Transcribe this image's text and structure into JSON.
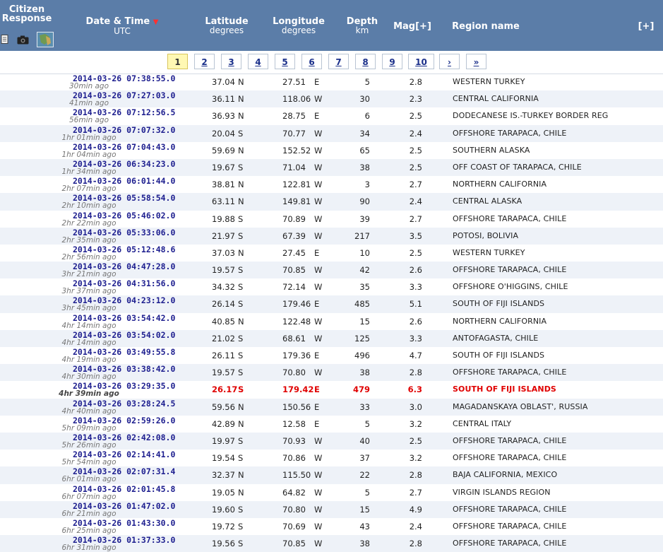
{
  "header": {
    "citizen": "Citizen",
    "response": "Response",
    "datetime": "Date & Time",
    "sort_arrow": "▼",
    "utc": "UTC",
    "latitude": "Latitude",
    "lat_unit": "degrees",
    "longitude": "Longitude",
    "lon_unit": "degrees",
    "depth": "Depth",
    "depth_unit": "km",
    "mag": "Mag[+]",
    "region": "Region name",
    "expand": "[+]"
  },
  "pager": [
    "1",
    "2",
    "3",
    "4",
    "5",
    "6",
    "7",
    "8",
    "9",
    "10",
    "›",
    "»"
  ],
  "rows": [
    {
      "datetime": "2014-03-26  07:38:55.0",
      "ago": "30min ago",
      "lat": "37.04",
      "ns": "N",
      "lon": "27.51",
      "ew": "E",
      "depth": "5",
      "mag": "2.8",
      "region": "WESTERN TURKEY"
    },
    {
      "datetime": "2014-03-26  07:27:03.0",
      "ago": "41min ago",
      "lat": "36.11",
      "ns": "N",
      "lon": "118.06",
      "ew": "W",
      "depth": "30",
      "mag": "2.3",
      "region": "CENTRAL CALIFORNIA"
    },
    {
      "datetime": "2014-03-26  07:12:56.5",
      "ago": "56min ago",
      "lat": "36.93",
      "ns": "N",
      "lon": "28.75",
      "ew": "E",
      "depth": "6",
      "mag": "2.5",
      "region": "DODECANESE IS.-TURKEY BORDER REG"
    },
    {
      "datetime": "2014-03-26  07:07:32.0",
      "ago": "1hr 01min ago",
      "lat": "20.04",
      "ns": "S",
      "lon": "70.77",
      "ew": "W",
      "depth": "34",
      "mag": "2.4",
      "region": "OFFSHORE TARAPACA, CHILE"
    },
    {
      "datetime": "2014-03-26  07:04:43.0",
      "ago": "1hr 04min ago",
      "lat": "59.69",
      "ns": "N",
      "lon": "152.52",
      "ew": "W",
      "depth": "65",
      "mag": "2.5",
      "region": "SOUTHERN ALASKA"
    },
    {
      "datetime": "2014-03-26  06:34:23.0",
      "ago": "1hr 34min ago",
      "lat": "19.67",
      "ns": "S",
      "lon": "71.04",
      "ew": "W",
      "depth": "38",
      "mag": "2.5",
      "region": "OFF COAST OF TARAPACA, CHILE"
    },
    {
      "datetime": "2014-03-26  06:01:44.0",
      "ago": "2hr 07min ago",
      "lat": "38.81",
      "ns": "N",
      "lon": "122.81",
      "ew": "W",
      "depth": "3",
      "mag": "2.7",
      "region": "NORTHERN CALIFORNIA"
    },
    {
      "datetime": "2014-03-26  05:58:54.0",
      "ago": "2hr 10min ago",
      "lat": "63.11",
      "ns": "N",
      "lon": "149.81",
      "ew": "W",
      "depth": "90",
      "mag": "2.4",
      "region": "CENTRAL ALASKA"
    },
    {
      "datetime": "2014-03-26  05:46:02.0",
      "ago": "2hr 22min ago",
      "lat": "19.88",
      "ns": "S",
      "lon": "70.89",
      "ew": "W",
      "depth": "39",
      "mag": "2.7",
      "region": "OFFSHORE TARAPACA, CHILE"
    },
    {
      "datetime": "2014-03-26  05:33:06.0",
      "ago": "2hr 35min ago",
      "lat": "21.97",
      "ns": "S",
      "lon": "67.39",
      "ew": "W",
      "depth": "217",
      "mag": "3.5",
      "region": "POTOSI, BOLIVIA"
    },
    {
      "datetime": "2014-03-26  05:12:48.6",
      "ago": "2hr 56min ago",
      "lat": "37.03",
      "ns": "N",
      "lon": "27.45",
      "ew": "E",
      "depth": "10",
      "mag": "2.5",
      "region": "WESTERN TURKEY"
    },
    {
      "datetime": "2014-03-26  04:47:28.0",
      "ago": "3hr 21min ago",
      "lat": "19.57",
      "ns": "S",
      "lon": "70.85",
      "ew": "W",
      "depth": "42",
      "mag": "2.6",
      "region": "OFFSHORE TARAPACA, CHILE"
    },
    {
      "datetime": "2014-03-26  04:31:56.0",
      "ago": "3hr 37min ago",
      "lat": "34.32",
      "ns": "S",
      "lon": "72.14",
      "ew": "W",
      "depth": "35",
      "mag": "3.3",
      "region": "OFFSHORE O'HIGGINS, CHILE"
    },
    {
      "datetime": "2014-03-26  04:23:12.0",
      "ago": "3hr 45min ago",
      "lat": "26.14",
      "ns": "S",
      "lon": "179.46",
      "ew": "E",
      "depth": "485",
      "mag": "5.1",
      "region": "SOUTH OF FIJI ISLANDS"
    },
    {
      "datetime": "2014-03-26  03:54:42.0",
      "ago": "4hr 14min ago",
      "lat": "40.85",
      "ns": "N",
      "lon": "122.48",
      "ew": "W",
      "depth": "15",
      "mag": "2.6",
      "region": "NORTHERN CALIFORNIA"
    },
    {
      "datetime": "2014-03-26  03:54:02.0",
      "ago": "4hr 14min ago",
      "lat": "21.02",
      "ns": "S",
      "lon": "68.61",
      "ew": "W",
      "depth": "125",
      "mag": "3.3",
      "region": "ANTOFAGASTA, CHILE"
    },
    {
      "datetime": "2014-03-26  03:49:55.8",
      "ago": "4hr 19min ago",
      "lat": "26.11",
      "ns": "S",
      "lon": "179.36",
      "ew": "E",
      "depth": "496",
      "mag": "4.7",
      "region": "SOUTH OF FIJI ISLANDS"
    },
    {
      "datetime": "2014-03-26  03:38:42.0",
      "ago": "4hr 30min ago",
      "lat": "19.57",
      "ns": "S",
      "lon": "70.80",
      "ew": "W",
      "depth": "38",
      "mag": "2.8",
      "region": "OFFSHORE TARAPACA, CHILE"
    },
    {
      "datetime": "2014-03-26  03:29:35.0",
      "ago": "4hr 39min ago",
      "lat": "26.17",
      "ns": "S",
      "lon": "179.42",
      "ew": "E",
      "depth": "479",
      "mag": "6.3",
      "region": "SOUTH OF FIJI ISLANDS",
      "highlight": true
    },
    {
      "datetime": "2014-03-26  03:28:24.5",
      "ago": "4hr 40min ago",
      "lat": "59.56",
      "ns": "N",
      "lon": "150.56",
      "ew": "E",
      "depth": "33",
      "mag": "3.0",
      "region": "MAGADANSKAYA OBLAST', RUSSIA"
    },
    {
      "datetime": "2014-03-26  02:59:26.0",
      "ago": "5hr 09min ago",
      "lat": "42.89",
      "ns": "N",
      "lon": "12.58",
      "ew": "E",
      "depth": "5",
      "mag": "3.2",
      "region": "CENTRAL ITALY"
    },
    {
      "datetime": "2014-03-26  02:42:08.0",
      "ago": "5hr 26min ago",
      "lat": "19.97",
      "ns": "S",
      "lon": "70.93",
      "ew": "W",
      "depth": "40",
      "mag": "2.5",
      "region": "OFFSHORE TARAPACA, CHILE"
    },
    {
      "datetime": "2014-03-26  02:14:41.0",
      "ago": "5hr 54min ago",
      "lat": "19.54",
      "ns": "S",
      "lon": "70.86",
      "ew": "W",
      "depth": "37",
      "mag": "3.2",
      "region": "OFFSHORE TARAPACA, CHILE"
    },
    {
      "datetime": "2014-03-26  02:07:31.4",
      "ago": "6hr 01min ago",
      "lat": "32.37",
      "ns": "N",
      "lon": "115.50",
      "ew": "W",
      "depth": "22",
      "mag": "2.8",
      "region": "BAJA CALIFORNIA, MEXICO"
    },
    {
      "datetime": "2014-03-26  02:01:45.8",
      "ago": "6hr 07min ago",
      "lat": "19.05",
      "ns": "N",
      "lon": "64.82",
      "ew": "W",
      "depth": "5",
      "mag": "2.7",
      "region": "VIRGIN ISLANDS REGION"
    },
    {
      "datetime": "2014-03-26  01:47:02.0",
      "ago": "6hr 21min ago",
      "lat": "19.60",
      "ns": "S",
      "lon": "70.80",
      "ew": "W",
      "depth": "15",
      "mag": "4.9",
      "region": "OFFSHORE TARAPACA, CHILE"
    },
    {
      "datetime": "2014-03-26  01:43:30.0",
      "ago": "6hr 25min ago",
      "lat": "19.72",
      "ns": "S",
      "lon": "70.69",
      "ew": "W",
      "depth": "43",
      "mag": "2.4",
      "region": "OFFSHORE TARAPACA, CHILE"
    },
    {
      "datetime": "2014-03-26  01:37:33.0",
      "ago": "6hr 31min ago",
      "lat": "19.56",
      "ns": "S",
      "lon": "70.85",
      "ew": "W",
      "depth": "38",
      "mag": "2.8",
      "region": "OFFSHORE TARAPACA, CHILE"
    }
  ],
  "colors": {
    "header_bg": "#5b7da8",
    "datetime": "#1d1e8f",
    "highlight": "#e00000",
    "alt_row": "#eef2f8",
    "current_page": "#fff8b4"
  },
  "icons": {
    "doc": "document-icon",
    "camera": "camera-icon",
    "map": "map-icon"
  }
}
